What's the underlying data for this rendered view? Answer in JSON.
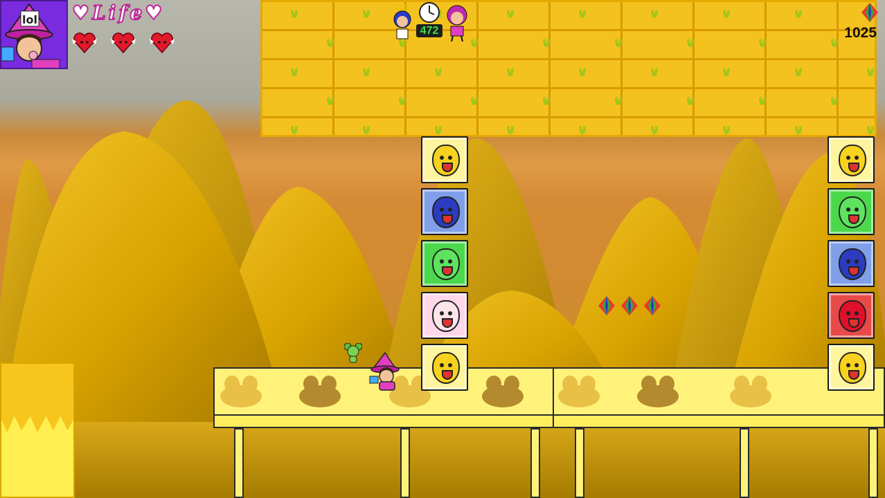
{
  "hud": {
    "life_label": "♥Life♥",
    "lives": 3,
    "timer": "472",
    "score": "1025",
    "icons": {
      "portrait": "witch-girl-portrait-icon",
      "heart": "winged-heart-icon",
      "clock": "clock-icon",
      "gem": "rainbow-gem-icon",
      "angel": "angel-character-icon",
      "rival": "pink-haired-girl-icon"
    }
  },
  "blocks": {
    "left_column": [
      "yellow-gourd-face",
      "blue-crying-face",
      "green-glasses-face",
      "pink-peach-face",
      "yellow-gourd-face"
    ],
    "right_column": [
      "yellow-gourd-face",
      "green-glasses-face",
      "blue-crying-face",
      "red-apple-face",
      "yellow-gourd-face"
    ]
  },
  "collectibles": {
    "gems_visible": 3
  },
  "colors": {
    "brick": "#f4c21f",
    "mortar": "#d99a00",
    "platform": "#fff27a",
    "hud_purple": "#7a2be0",
    "timer_green": "#3fe04a"
  }
}
